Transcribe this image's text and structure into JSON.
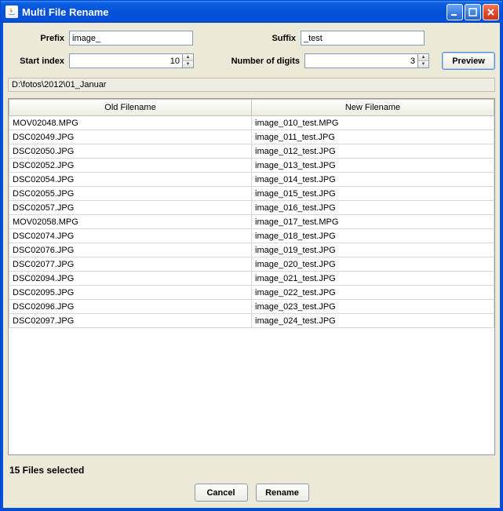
{
  "window": {
    "title": "Multi File Rename"
  },
  "form": {
    "prefix_label": "Prefix",
    "prefix_value": "image_",
    "suffix_label": "Suffix",
    "suffix_value": "_test",
    "start_index_label": "Start index",
    "start_index_value": "10",
    "digits_label": "Number of digits",
    "digits_value": "3",
    "preview_label": "Preview"
  },
  "path": "D:\\fotos\\2012\\01_Januar",
  "table": {
    "col_old": "Old Filename",
    "col_new": "New Filename",
    "rows": [
      {
        "old": "MOV02048.MPG",
        "new": "image_010_test.MPG"
      },
      {
        "old": "DSC02049.JPG",
        "new": "image_011_test.JPG"
      },
      {
        "old": "DSC02050.JPG",
        "new": "image_012_test.JPG"
      },
      {
        "old": "DSC02052.JPG",
        "new": "image_013_test.JPG"
      },
      {
        "old": "DSC02054.JPG",
        "new": "image_014_test.JPG"
      },
      {
        "old": "DSC02055.JPG",
        "new": "image_015_test.JPG"
      },
      {
        "old": "DSC02057.JPG",
        "new": "image_016_test.JPG"
      },
      {
        "old": "MOV02058.MPG",
        "new": "image_017_test.MPG"
      },
      {
        "old": "DSC02074.JPG",
        "new": "image_018_test.JPG"
      },
      {
        "old": "DSC02076.JPG",
        "new": "image_019_test.JPG"
      },
      {
        "old": "DSC02077.JPG",
        "new": "image_020_test.JPG"
      },
      {
        "old": "DSC02094.JPG",
        "new": "image_021_test.JPG"
      },
      {
        "old": "DSC02095.JPG",
        "new": "image_022_test.JPG"
      },
      {
        "old": "DSC02096.JPG",
        "new": "image_023_test.JPG"
      },
      {
        "old": "DSC02097.JPG",
        "new": "image_024_test.JPG"
      }
    ]
  },
  "status": "15 Files selected",
  "buttons": {
    "cancel": "Cancel",
    "rename": "Rename"
  }
}
